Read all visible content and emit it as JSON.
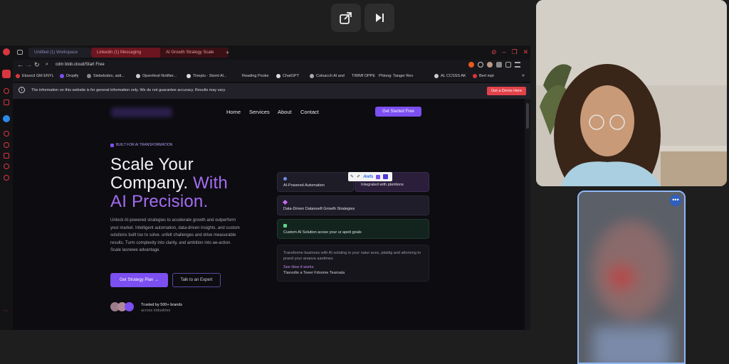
{
  "call_controls": {
    "popout_icon": "popout-icon",
    "next_icon": "skip-next-icon"
  },
  "browser": {
    "tabs": [
      "Untitled (1) Workspace",
      "Linkedin (1) Messaging",
      "AI Growth Strategy Scale"
    ],
    "url": "cdm blob.cloud/Start Free",
    "bookmarks": [
      "Ebsocd GM ENYL",
      "Dropify",
      "Siebebsbrs, astt...",
      "OpenHost Notifier...",
      "Tineplu - Stoml Al...",
      "Reading Pooke",
      "ChatGPT",
      "Coloacch Al and",
      "TIWMf OPPE",
      "Phlong: Tanger Rev",
      "AL CCSSS AK",
      "Bert mpt"
    ],
    "info_text": "The information on this website is for general information only. We do not guarantee accuracy. Results may vary.",
    "info_button": "Get a Demo Here"
  },
  "site": {
    "nav": [
      "Home",
      "Services",
      "About",
      "Contact"
    ],
    "cta_nav": "Get Started Free",
    "badge": "BUILT FOR AI TRANSFORMATION",
    "headline_1": "Scale Your",
    "headline_2a": "Company.",
    "headline_2b": "With",
    "headline_3": "AI Precision.",
    "body": "Unlock AI-powered strategies to accelerate growth and outperform your market. Intelligent automation, data-driven insights, and custom solutions built too to solve. unfelt challenges and drive measurable results. Turm complexity into clarity, and ambition into ae-action. Scale lasnewe advantage.",
    "primary_button": "Get Strategy Plan",
    "secondary_button": "Talk to an Expert",
    "trusted_title": "Trusted by 500+ brands",
    "trusted_sub": "across industries",
    "cards": {
      "c1": "AI-Powered Automation",
      "c2": "Integrated with ptentions",
      "popup": "Awts",
      "c3": "Data-Driven Datanoeft Growth Strategies",
      "c4": "Custom AI Solution acose your ur apeit goals",
      "c5_text": "Transforme business with AI soluting is your natur aces, pitatiig and attoriong to prand your anaova aaotimes",
      "c5_link": "See How it works",
      "c5_sub": "Tlavvolte a Teeer   Fdoome Tearoala"
    }
  },
  "colors": {
    "accent": "#7b4ff0",
    "danger": "#d9363e",
    "green": "#5bd48a"
  }
}
